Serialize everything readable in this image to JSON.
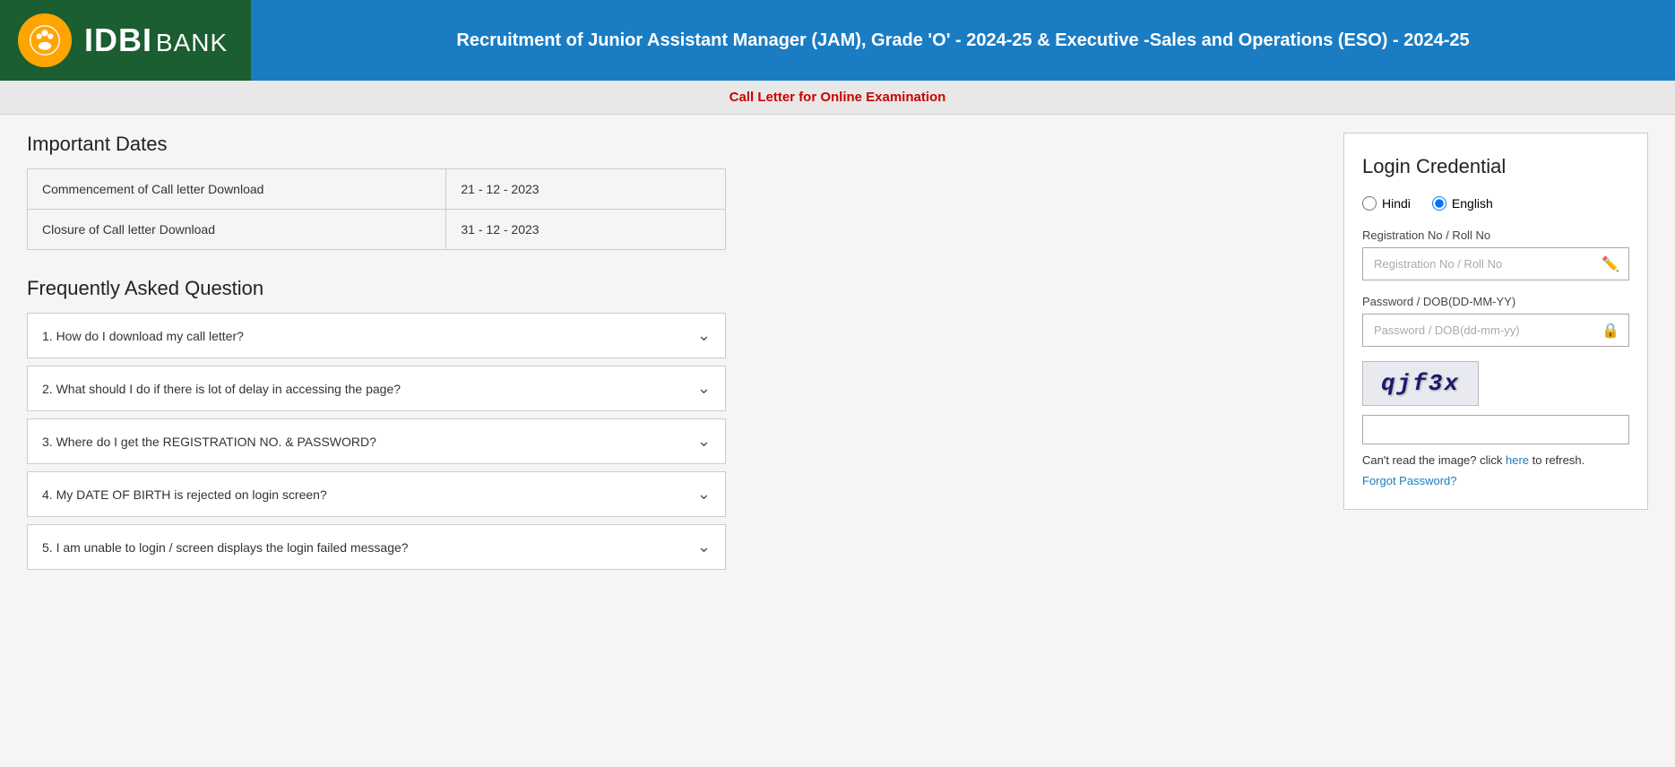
{
  "header": {
    "logo_text": "IDBI",
    "logo_subtext": "BANK",
    "title": "Recruitment of Junior Assistant Manager (JAM), Grade 'O' - 2024-25 & Executive -Sales and Operations (ESO) - 2024-25"
  },
  "sub_header": {
    "text": "Call Letter for Online Examination"
  },
  "important_dates": {
    "section_title": "Important Dates",
    "rows": [
      {
        "label": "Commencement of Call letter Download",
        "value": "21 - 12 - 2023"
      },
      {
        "label": "Closure of Call letter Download",
        "value": "31 - 12 - 2023"
      }
    ]
  },
  "faq": {
    "section_title": "Frequently Asked Question",
    "items": [
      {
        "id": 1,
        "question": "1. How do I download my call letter?"
      },
      {
        "id": 2,
        "question": "2. What should I do if there is lot of delay in accessing the page?"
      },
      {
        "id": 3,
        "question": "3. Where do I get the REGISTRATION NO. & PASSWORD?"
      },
      {
        "id": 4,
        "question": "4. My DATE OF BIRTH is rejected on login screen?"
      },
      {
        "id": 5,
        "question": "5. I am unable to login / screen displays the login failed message?"
      }
    ]
  },
  "login": {
    "title": "Login Credential",
    "lang_hindi": "Hindi",
    "lang_english": "English",
    "reg_label": "Registration No / Roll No",
    "reg_placeholder": "Registration No / Roll No",
    "password_label": "Password / DOB(DD-MM-YY)",
    "password_placeholder": "Password / DOB(dd-mm-yy)",
    "captcha_text": "qjf3x",
    "captcha_hint_prefix": "Can't read the image? click ",
    "captcha_hint_link": "here",
    "captcha_hint_suffix": " to refresh.",
    "forgot_password": "Forgot Password?"
  }
}
